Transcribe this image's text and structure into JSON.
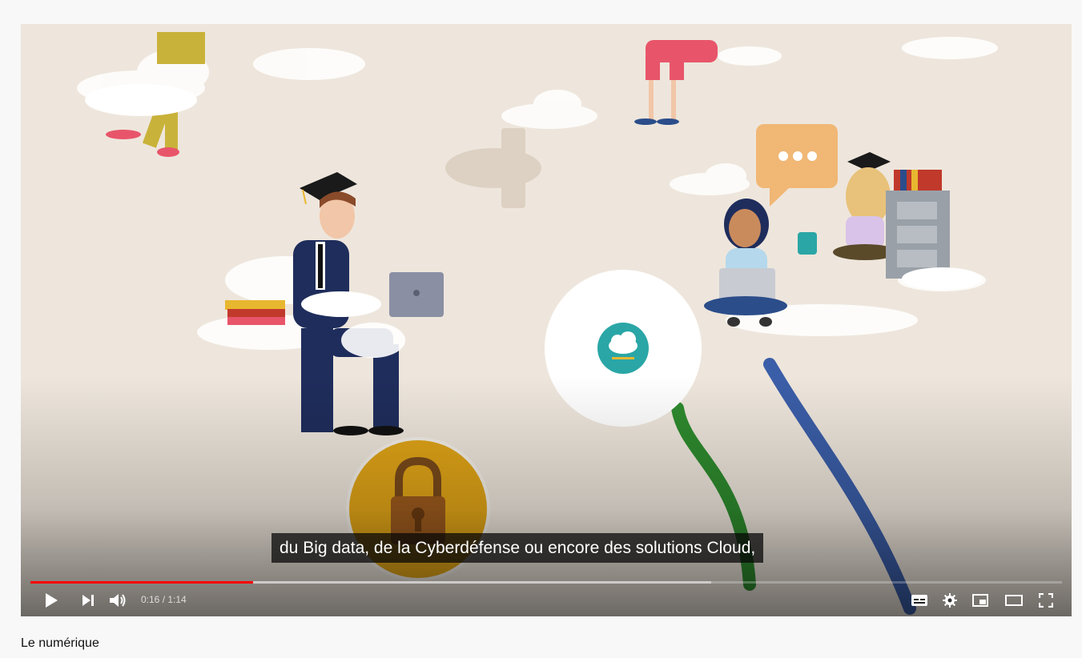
{
  "player": {
    "caption": "du Big data, de la Cyberdéfense ou encore des solutions Cloud,",
    "time": {
      "current": "0:16",
      "separator": " / ",
      "duration": "1:14"
    },
    "progress": {
      "played_fraction": 0.216,
      "loaded_fraction": 0.66
    },
    "accent_color": "#ff0000",
    "controls": {
      "play_icon": "play-icon",
      "next_icon": "next-icon",
      "volume_icon": "volume-icon",
      "subtitles_icon": "subtitles-icon",
      "settings_icon": "settings-icon",
      "miniplayer_icon": "miniplayer-icon",
      "theater_icon": "theater-icon",
      "fullscreen_icon": "fullscreen-icon"
    }
  },
  "video": {
    "title": "Le numérique"
  }
}
